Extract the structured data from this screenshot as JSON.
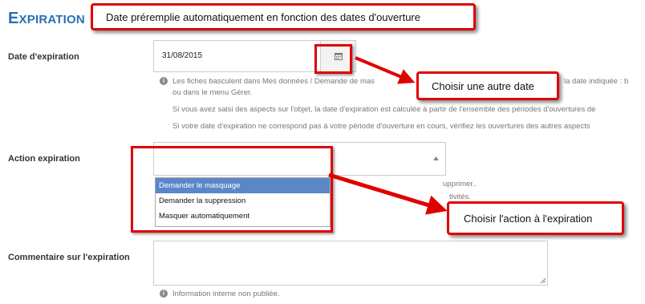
{
  "section": {
    "title_initial": "E",
    "title_rest": "XPIRATION"
  },
  "expiration": {
    "label": "Date d'expiration",
    "value": "31/08/2015",
    "help": [
      "Les fiches basculent dans Mes données / Demande de mas",
      "la date indiquée : b",
      "ou dans le menu Gérer.",
      "Si vous avez saisi des aspects sur l'objet, la date d'expiration est calculée à partir de l'ensemble des périodes d'ouvertures de",
      "Si votre date d'expiration ne correspond pas à votre période d'ouverture en cours, vérifiez les ouvertures des autres aspects"
    ]
  },
  "action": {
    "label": "Action expiration",
    "options": [
      "Demander le masquage",
      "Demander la suppression",
      "Masquer automatiquement"
    ],
    "help_fragments": [
      "upprimer..",
      "tivités."
    ]
  },
  "comment": {
    "label": "Commentaire sur l'expiration",
    "help": "Information interne non publiée."
  },
  "callouts": {
    "prefill": "Date préremplie automatiquement en fonction des dates d'ouverture",
    "other_date": "Choisir une autre date",
    "choose_action": "Choisir l'action à l'expiration"
  },
  "colors": {
    "accent": "#2a70b0",
    "annotation_red": "#e00000",
    "selected_option": "#5b87c9"
  },
  "icons": {
    "calendar": "calendar-icon",
    "info": "info-icon",
    "dropdown": "caret-up-icon",
    "resize": "resize-grip-icon"
  }
}
